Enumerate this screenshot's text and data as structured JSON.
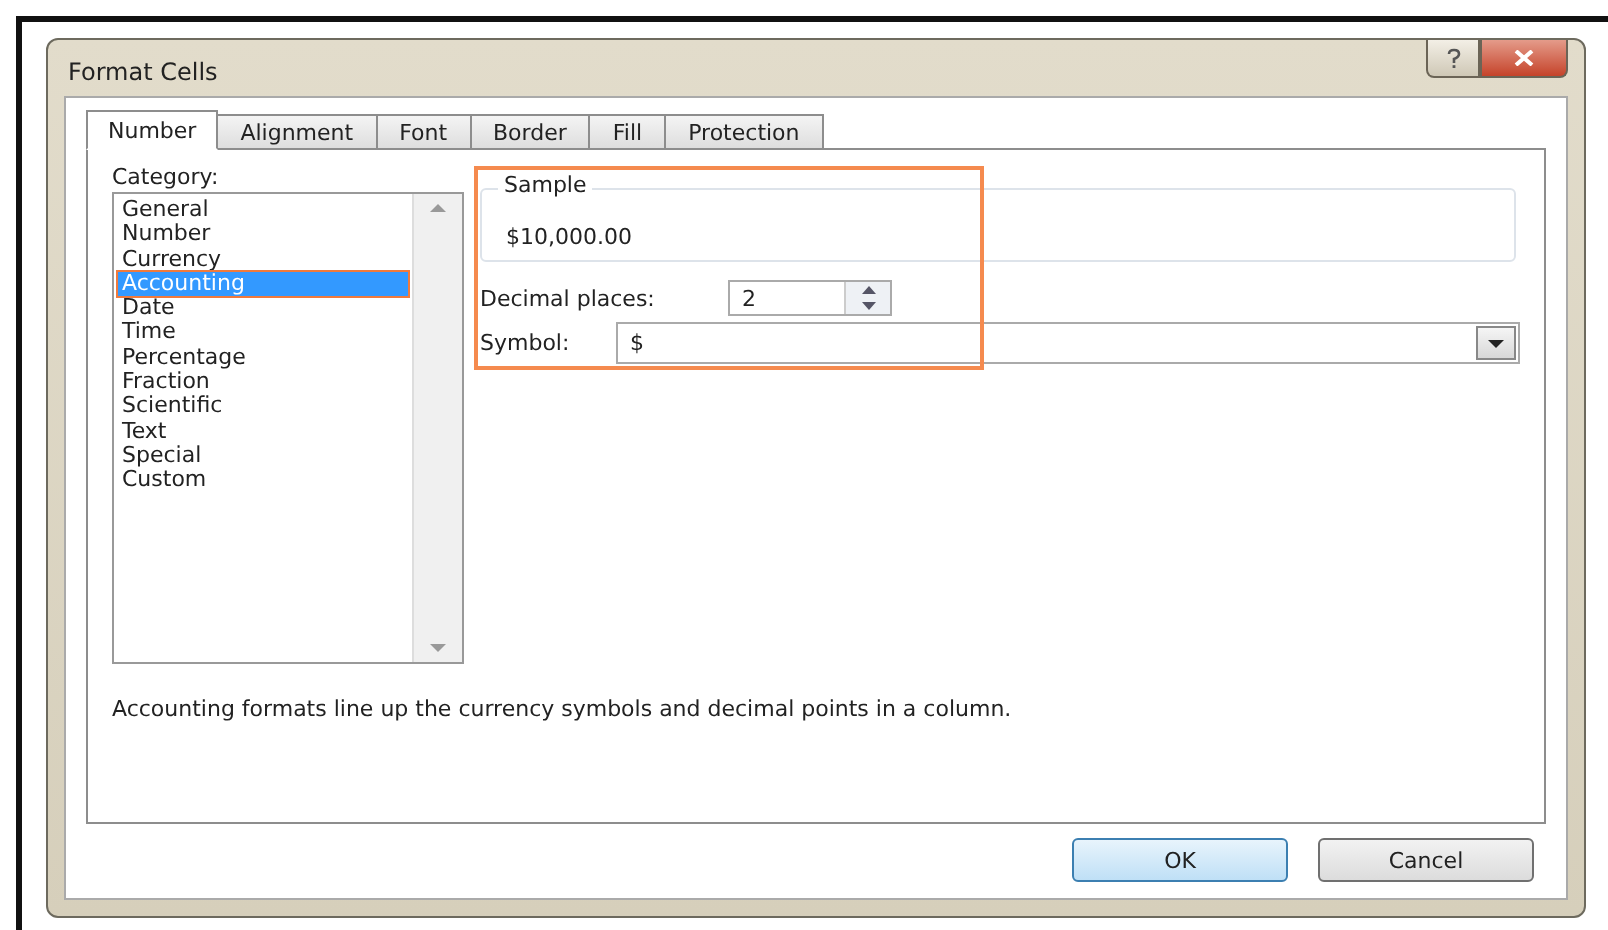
{
  "window": {
    "title": "Format Cells"
  },
  "tabs": [
    {
      "label": "Number",
      "selected": true
    },
    {
      "label": "Alignment",
      "selected": false
    },
    {
      "label": "Font",
      "selected": false
    },
    {
      "label": "Border",
      "selected": false
    },
    {
      "label": "Fill",
      "selected": false
    },
    {
      "label": "Protection",
      "selected": false
    }
  ],
  "category": {
    "label": "Category:",
    "items": [
      {
        "label": "General",
        "selected": false
      },
      {
        "label": "Number",
        "selected": false
      },
      {
        "label": "Currency",
        "selected": false
      },
      {
        "label": "Accounting",
        "selected": true
      },
      {
        "label": "Date",
        "selected": false
      },
      {
        "label": "Time",
        "selected": false
      },
      {
        "label": "Percentage",
        "selected": false
      },
      {
        "label": "Fraction",
        "selected": false
      },
      {
        "label": "Scientific",
        "selected": false
      },
      {
        "label": "Text",
        "selected": false
      },
      {
        "label": "Special",
        "selected": false
      },
      {
        "label": "Custom",
        "selected": false
      }
    ]
  },
  "sample": {
    "label": "Sample",
    "value": "$10,000.00"
  },
  "decimal_places": {
    "label": "Decimal places:",
    "value": "2"
  },
  "symbol": {
    "label": "Symbol:",
    "value": "$"
  },
  "description": "Accounting formats line up the currency symbols and decimal points in a column.",
  "buttons": [
    {
      "label": "OK",
      "kind": "default"
    },
    {
      "label": "Cancel",
      "kind": "normal"
    }
  ]
}
